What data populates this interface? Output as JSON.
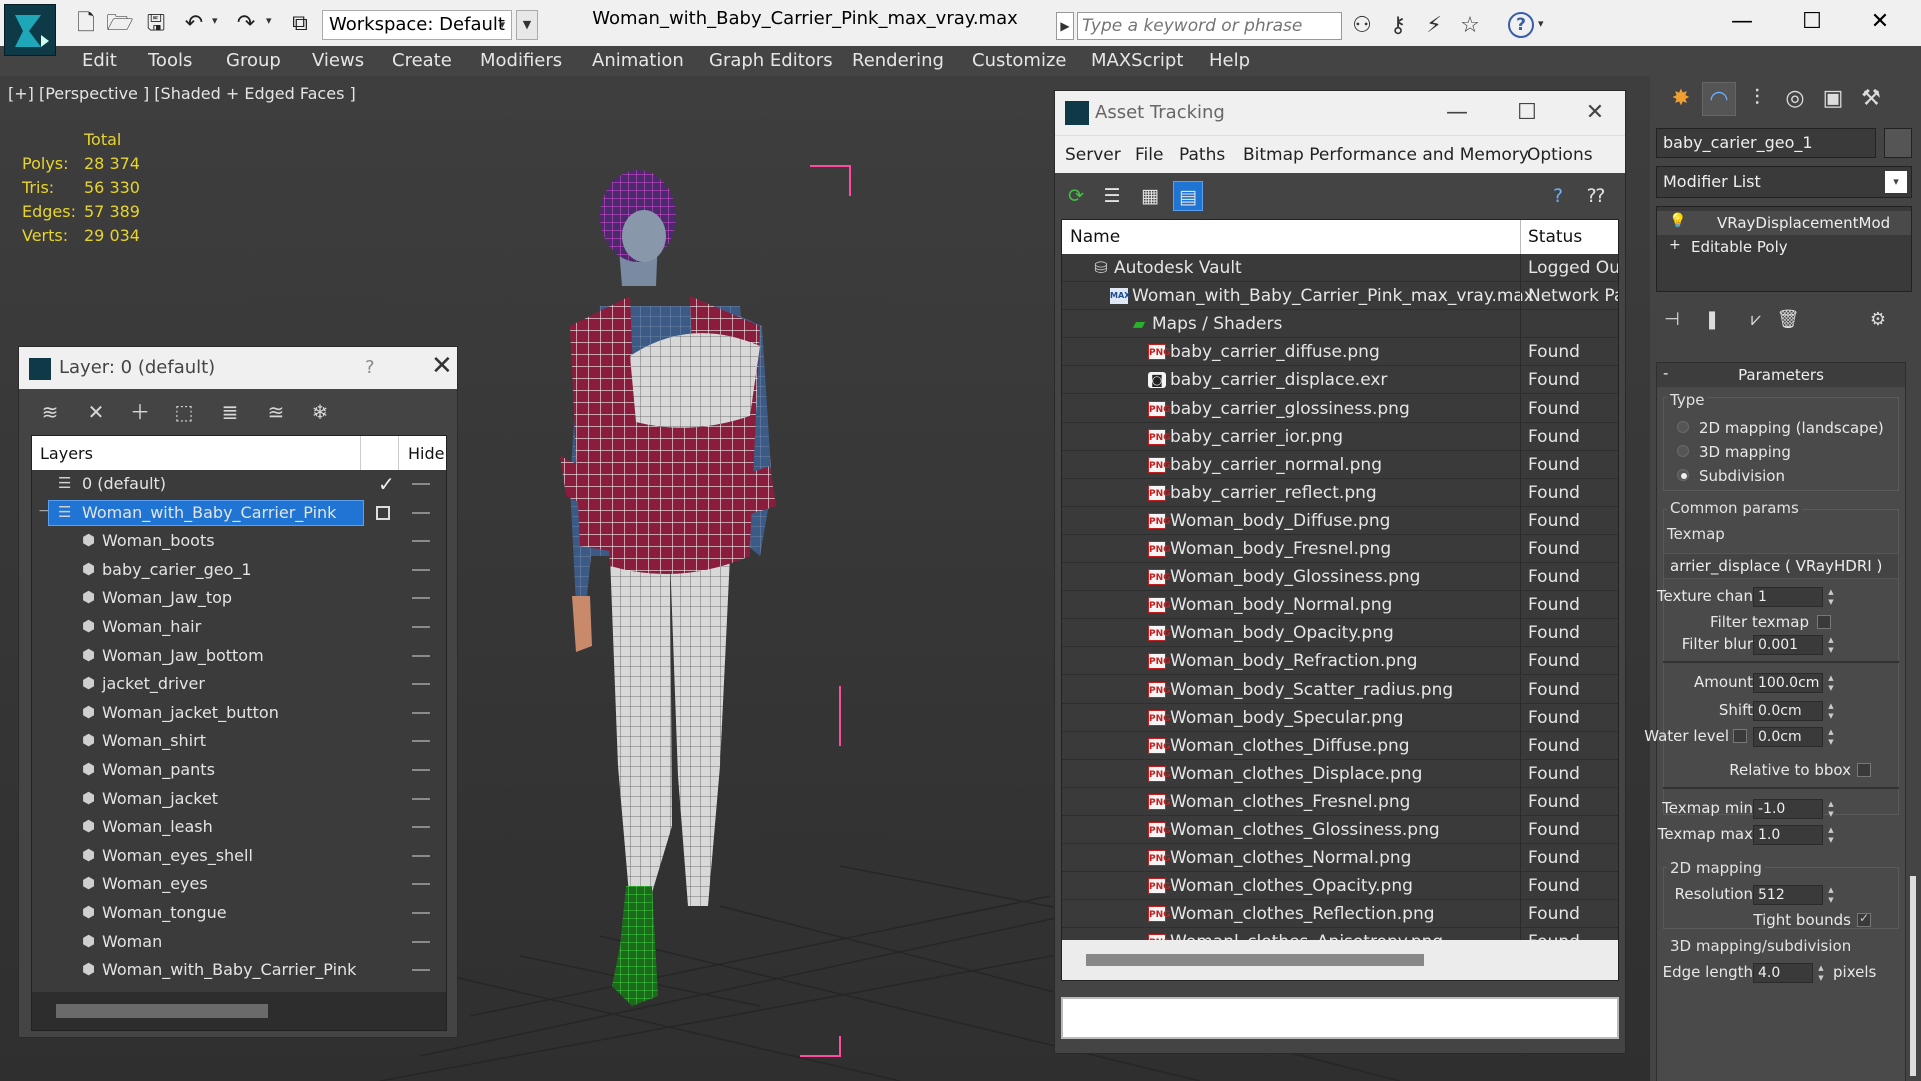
{
  "app": {
    "window_title": "Woman_with_Baby_Carrier_Pink_max_vray.max",
    "workspace_label": "Workspace: Default",
    "search_placeholder": "Type a keyword or phrase"
  },
  "menu": [
    "Edit",
    "Tools",
    "Group",
    "Views",
    "Create",
    "Modifiers",
    "Animation",
    "Graph Editors",
    "Rendering",
    "Customize",
    "MAXScript",
    "Help"
  ],
  "viewport": {
    "label": "[+] [Perspective ] [Shaded + Edged Faces ]",
    "stats": {
      "header": "Total",
      "rows": [
        {
          "label": "Polys:",
          "value": "28 374"
        },
        {
          "label": "Tris:",
          "value": "56 330"
        },
        {
          "label": "Edges:",
          "value": "57 389"
        },
        {
          "label": "Verts:",
          "value": "29 034"
        }
      ]
    }
  },
  "layer_dialog": {
    "title": "Layer: 0 (default)",
    "help": "?",
    "col_layers": "Layers",
    "col_hide": "Hide",
    "rows": [
      {
        "name": "0 (default)",
        "level": 0,
        "icon": "layer-stack-icon",
        "checked": true
      },
      {
        "name": "Woman_with_Baby_Carrier_Pink",
        "level": 0,
        "icon": "layer-stack-icon",
        "selected": true,
        "expander": "−"
      },
      {
        "name": "Woman_boots",
        "level": 1,
        "icon": "object-icon"
      },
      {
        "name": "baby_carier_geo_1",
        "level": 1,
        "icon": "object-icon"
      },
      {
        "name": "Woman_Jaw_top",
        "level": 1,
        "icon": "object-icon"
      },
      {
        "name": "Woman_hair",
        "level": 1,
        "icon": "object-icon"
      },
      {
        "name": "Woman_Jaw_bottom",
        "level": 1,
        "icon": "object-icon"
      },
      {
        "name": "jacket_driver",
        "level": 1,
        "icon": "object-icon"
      },
      {
        "name": "Woman_jacket_button",
        "level": 1,
        "icon": "object-icon"
      },
      {
        "name": "Woman_shirt",
        "level": 1,
        "icon": "object-icon"
      },
      {
        "name": "Woman_pants",
        "level": 1,
        "icon": "object-icon"
      },
      {
        "name": "Woman_jacket",
        "level": 1,
        "icon": "object-icon"
      },
      {
        "name": "Woman_leash",
        "level": 1,
        "icon": "object-icon"
      },
      {
        "name": "Woman_eyes_shell",
        "level": 1,
        "icon": "object-icon"
      },
      {
        "name": "Woman_eyes",
        "level": 1,
        "icon": "object-icon"
      },
      {
        "name": "Woman_tongue",
        "level": 1,
        "icon": "object-icon"
      },
      {
        "name": "Woman",
        "level": 1,
        "icon": "object-icon"
      },
      {
        "name": "Woman_with_Baby_Carrier_Pink",
        "level": 1,
        "icon": "object-icon"
      }
    ]
  },
  "asset_dialog": {
    "title": "Asset Tracking",
    "menus": [
      "Server",
      "File",
      "Paths",
      "Bitmap Performance and Memory",
      "Options"
    ],
    "col_name": "Name",
    "col_status": "Status",
    "rows": [
      {
        "name": "Autodesk Vault",
        "status": "Logged Out",
        "level": 1,
        "icon": "vault"
      },
      {
        "name": "Woman_with_Baby_Carrier_Pink_max_vray.max",
        "status": "Network Path",
        "level": 2,
        "icon": "max"
      },
      {
        "name": "Maps / Shaders",
        "status": "",
        "level": 3,
        "icon": "maps"
      },
      {
        "name": "baby_carrier_diffuse.png",
        "status": "Found",
        "level": 4,
        "icon": "png"
      },
      {
        "name": "baby_carrier_displace.exr",
        "status": "Found",
        "level": 4,
        "icon": "exr"
      },
      {
        "name": "baby_carrier_glossiness.png",
        "status": "Found",
        "level": 4,
        "icon": "png"
      },
      {
        "name": "baby_carrier_ior.png",
        "status": "Found",
        "level": 4,
        "icon": "png"
      },
      {
        "name": "baby_carrier_normal.png",
        "status": "Found",
        "level": 4,
        "icon": "png"
      },
      {
        "name": "baby_carrier_reflect.png",
        "status": "Found",
        "level": 4,
        "icon": "png"
      },
      {
        "name": "Woman_body_Diffuse.png",
        "status": "Found",
        "level": 4,
        "icon": "png"
      },
      {
        "name": "Woman_body_Fresnel.png",
        "status": "Found",
        "level": 4,
        "icon": "png"
      },
      {
        "name": "Woman_body_Glossiness.png",
        "status": "Found",
        "level": 4,
        "icon": "png"
      },
      {
        "name": "Woman_body_Normal.png",
        "status": "Found",
        "level": 4,
        "icon": "png"
      },
      {
        "name": "Woman_body_Opacity.png",
        "status": "Found",
        "level": 4,
        "icon": "png"
      },
      {
        "name": "Woman_body_Refraction.png",
        "status": "Found",
        "level": 4,
        "icon": "png"
      },
      {
        "name": "Woman_body_Scatter_radius.png",
        "status": "Found",
        "level": 4,
        "icon": "png"
      },
      {
        "name": "Woman_body_Specular.png",
        "status": "Found",
        "level": 4,
        "icon": "png"
      },
      {
        "name": "Woman_clothes_Diffuse.png",
        "status": "Found",
        "level": 4,
        "icon": "png"
      },
      {
        "name": "Woman_clothes_Displace.png",
        "status": "Found",
        "level": 4,
        "icon": "png"
      },
      {
        "name": "Woman_clothes_Fresnel.png",
        "status": "Found",
        "level": 4,
        "icon": "png"
      },
      {
        "name": "Woman_clothes_Glossiness.png",
        "status": "Found",
        "level": 4,
        "icon": "png"
      },
      {
        "name": "Woman_clothes_Normal.png",
        "status": "Found",
        "level": 4,
        "icon": "png"
      },
      {
        "name": "Woman_clothes_Opacity.png",
        "status": "Found",
        "level": 4,
        "icon": "png"
      },
      {
        "name": "Woman_clothes_Reflection.png",
        "status": "Found",
        "level": 4,
        "icon": "png"
      },
      {
        "name": "Womanl_clothes_Anisotropy.png",
        "status": "Found",
        "level": 4,
        "icon": "png"
      }
    ]
  },
  "command_panel": {
    "object_name": "baby_carier_geo_1",
    "modifier_list": "Modifier List",
    "stack": [
      {
        "label": "VRayDisplacementMod",
        "icon": "💡"
      },
      {
        "label": "Editable Poly",
        "icon": "+"
      }
    ],
    "params_title": "Parameters",
    "type_label": "Type",
    "type_options": [
      {
        "label": "2D mapping (landscape)",
        "on": false
      },
      {
        "label": "3D mapping",
        "on": false
      },
      {
        "label": "Subdivision",
        "on": true
      }
    ],
    "common_params": "Common params",
    "texmap_label": "Texmap",
    "texmap_value": "arrier_displace  ( VRayHDRI )",
    "texture_chan_label": "Texture chan",
    "texture_chan_value": "1",
    "filter_texmap_label": "Filter texmap",
    "filter_blur_label": "Filter blur",
    "filter_blur_value": "0.001",
    "amount_label": "Amount",
    "amount_value": "100.0cm",
    "shift_label": "Shift",
    "shift_value": "0.0cm",
    "water_level_label": "Water level",
    "water_level_value": "0.0cm",
    "relative_bbox_label": "Relative to bbox",
    "texmap_min_label": "Texmap min",
    "texmap_min_value": "-1.0",
    "texmap_max_label": "Texmap max",
    "texmap_max_value": "1.0",
    "mapping2d_label": "2D mapping",
    "resolution_label": "Resolution",
    "resolution_value": "512",
    "tight_bounds_label": "Tight bounds",
    "mapping3d_label": "3D mapping/subdivision",
    "edge_length_label": "Edge length",
    "edge_length_value": "4.0",
    "edge_length_unit": "pixels"
  }
}
